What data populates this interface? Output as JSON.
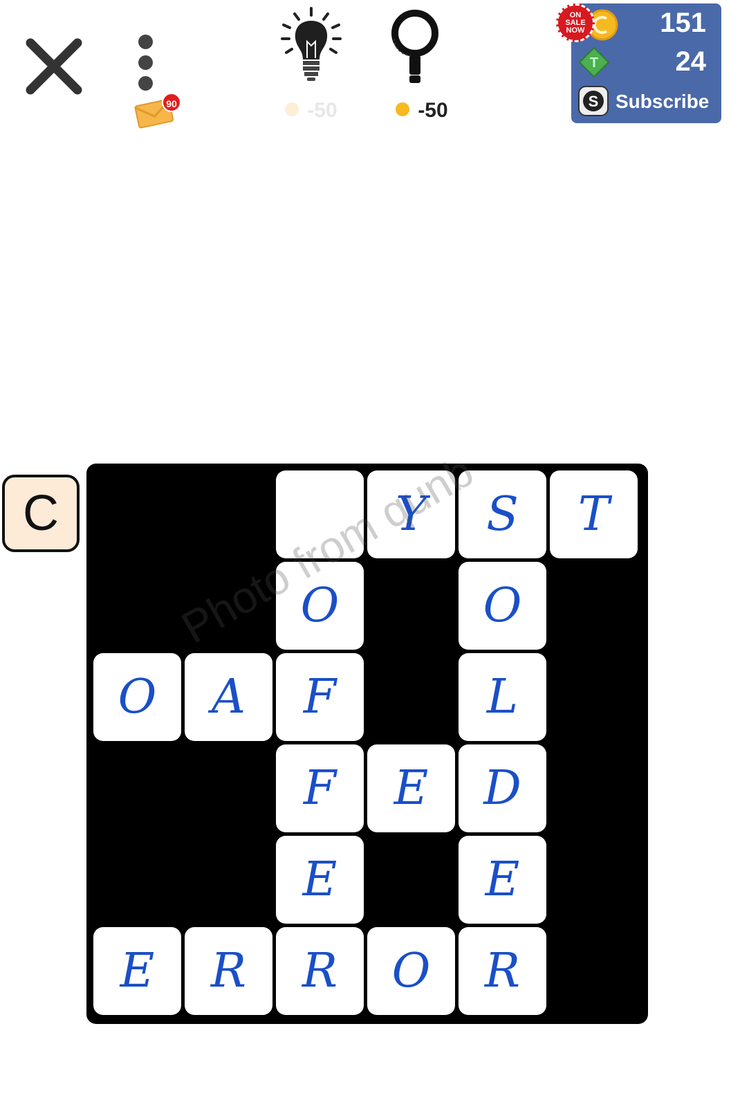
{
  "header": {
    "close_icon": "close-icon",
    "menu_icon": "kebab-menu-icon",
    "mail": {
      "icon": "envelope-icon",
      "badge_count": "90"
    },
    "hint": {
      "icon": "lightbulb-icon",
      "cost": "-50",
      "enabled": false
    },
    "reveal": {
      "icon": "magnifier-icon",
      "cost": "-50",
      "enabled": true
    }
  },
  "wallet": {
    "sale_badge": [
      "ON",
      "SALE",
      "NOW"
    ],
    "coins": "151",
    "tokens": "24",
    "subscribe_label": "Subscribe"
  },
  "clue_letter": "C",
  "watermark": "Photo from qunb",
  "colors": {
    "accent_blue": "#1a4fc7",
    "wallet_bg": "#4a69a8",
    "board_bg": "#000000",
    "clue_bg": "#fdebd8",
    "coin_gold": "#f5b921",
    "token_green": "#4caf50"
  },
  "board": {
    "rows": 6,
    "cols": 6,
    "cells": [
      {
        "row": 0,
        "col": 2,
        "letter": ""
      },
      {
        "row": 0,
        "col": 3,
        "letter": "Y"
      },
      {
        "row": 0,
        "col": 4,
        "letter": "S"
      },
      {
        "row": 0,
        "col": 5,
        "letter": "T"
      },
      {
        "row": 1,
        "col": 2,
        "letter": "O"
      },
      {
        "row": 1,
        "col": 4,
        "letter": "O"
      },
      {
        "row": 2,
        "col": 0,
        "letter": "O"
      },
      {
        "row": 2,
        "col": 1,
        "letter": "A"
      },
      {
        "row": 2,
        "col": 2,
        "letter": "F"
      },
      {
        "row": 2,
        "col": 4,
        "letter": "L"
      },
      {
        "row": 3,
        "col": 2,
        "letter": "F"
      },
      {
        "row": 3,
        "col": 3,
        "letter": "E"
      },
      {
        "row": 3,
        "col": 4,
        "letter": "D"
      },
      {
        "row": 4,
        "col": 2,
        "letter": "E"
      },
      {
        "row": 4,
        "col": 4,
        "letter": "E"
      },
      {
        "row": 5,
        "col": 0,
        "letter": "E"
      },
      {
        "row": 5,
        "col": 1,
        "letter": "R"
      },
      {
        "row": 5,
        "col": 2,
        "letter": "R"
      },
      {
        "row": 5,
        "col": 3,
        "letter": "O"
      },
      {
        "row": 5,
        "col": 4,
        "letter": "R"
      }
    ]
  }
}
